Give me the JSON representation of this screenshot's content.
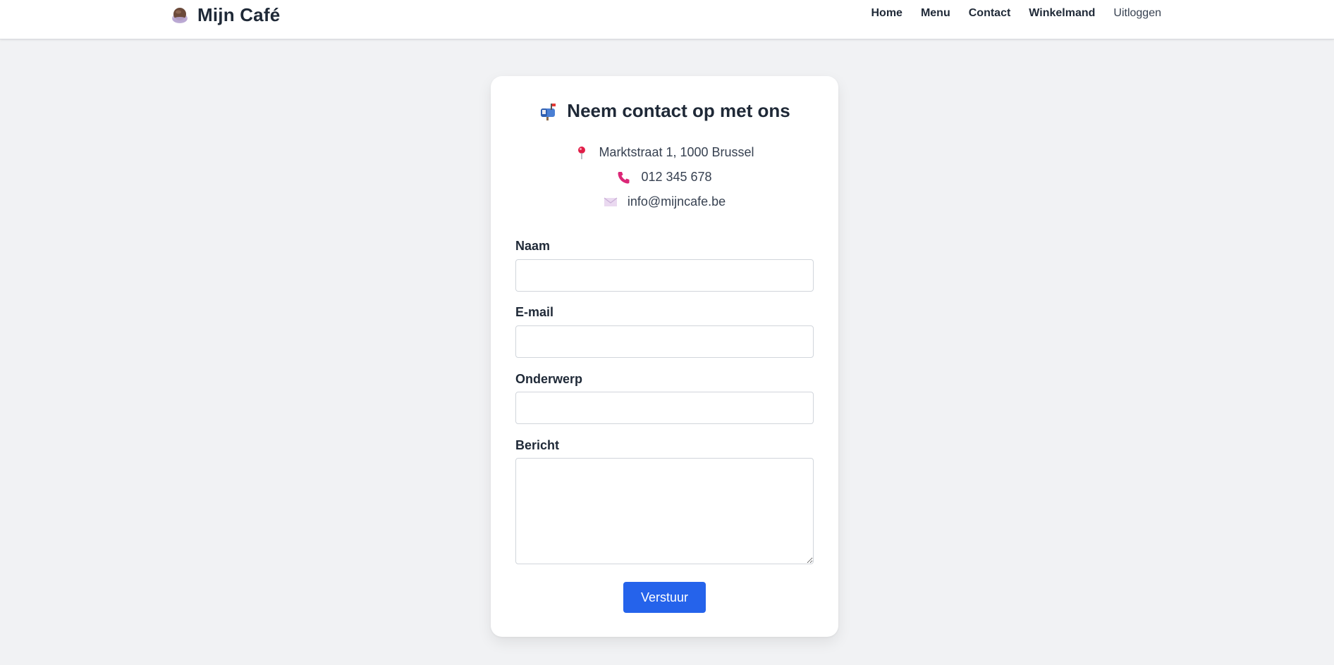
{
  "header": {
    "brand_title": "Mijn Café",
    "brand_icon": "coffee-cup-icon",
    "nav": [
      {
        "label": "Home"
      },
      {
        "label": "Menu"
      },
      {
        "label": "Contact"
      },
      {
        "label": "Winkelmand"
      },
      {
        "label": "Uitloggen"
      }
    ]
  },
  "contact": {
    "title": "Neem contact op met ons",
    "title_icon": "mailbox-icon",
    "address": "Marktstraat 1, 1000 Brussel",
    "phone": "012 345 678",
    "email": "info@mijncafe.be",
    "icons": {
      "address": "pin-icon",
      "phone": "phone-icon",
      "email": "envelope-icon"
    }
  },
  "form": {
    "name_label": "Naam",
    "name_value": "",
    "email_label": "E-mail",
    "email_value": "",
    "subject_label": "Onderwerp",
    "subject_value": "",
    "message_label": "Bericht",
    "message_value": "",
    "submit_label": "Verstuur"
  },
  "colors": {
    "accent": "#2563eb",
    "background": "#f1f2f4",
    "card": "#ffffff",
    "text": "#1f2937",
    "pin": "#e11d48",
    "phone": "#db2777"
  }
}
